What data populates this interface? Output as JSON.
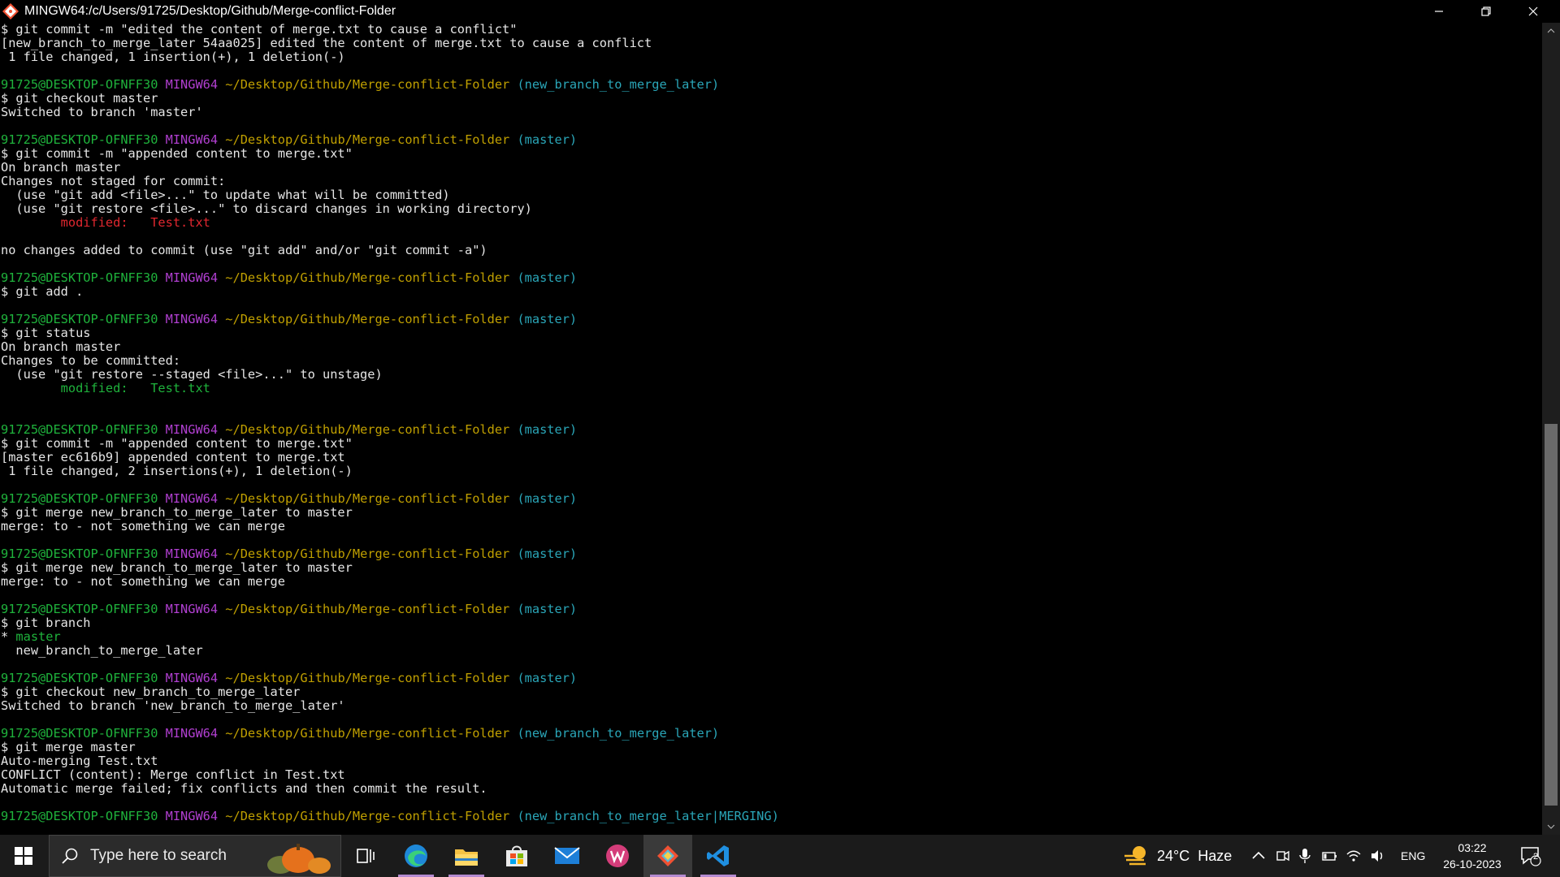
{
  "window": {
    "title": "MINGW64:/c/Users/91725/Desktop/Github/Merge-conflict-Folder"
  },
  "terminal": {
    "lines": [
      [
        {
          "t": "$ git commit -m \"edited the content of merge.txt to cause a conflict\"",
          "c": "w"
        }
      ],
      [
        {
          "t": "[new_branch_to_merge_later 54aa025] edited the content of merge.txt to cause a conflict",
          "c": "w"
        }
      ],
      [
        {
          "t": " 1 file changed, 1 insertion(+), 1 deletion(-)",
          "c": "w"
        }
      ],
      [],
      [
        {
          "t": "91725@DESKTOP-OFNFF30 ",
          "c": "g"
        },
        {
          "t": "MINGW64 ",
          "c": "m"
        },
        {
          "t": "~/Desktop/Github/Merge-conflict-Folder ",
          "c": "y"
        },
        {
          "t": "(new_branch_to_merge_later)",
          "c": "c"
        }
      ],
      [
        {
          "t": "$ git checkout master",
          "c": "w"
        }
      ],
      [
        {
          "t": "Switched to branch 'master'",
          "c": "w"
        }
      ],
      [],
      [
        {
          "t": "91725@DESKTOP-OFNFF30 ",
          "c": "g"
        },
        {
          "t": "MINGW64 ",
          "c": "m"
        },
        {
          "t": "~/Desktop/Github/Merge-conflict-Folder ",
          "c": "y"
        },
        {
          "t": "(master)",
          "c": "c"
        }
      ],
      [
        {
          "t": "$ git commit -m \"appended content to merge.txt\"",
          "c": "w"
        }
      ],
      [
        {
          "t": "On branch master",
          "c": "w"
        }
      ],
      [
        {
          "t": "Changes not staged for commit:",
          "c": "w"
        }
      ],
      [
        {
          "t": "  (use \"git add <file>...\" to update what will be committed)",
          "c": "w"
        }
      ],
      [
        {
          "t": "  (use \"git restore <file>...\" to discard changes in working directory)",
          "c": "w"
        }
      ],
      [
        {
          "t": "        modified:   Test.txt",
          "c": "r"
        }
      ],
      [],
      [
        {
          "t": "no changes added to commit (use \"git add\" and/or \"git commit -a\")",
          "c": "w"
        }
      ],
      [],
      [
        {
          "t": "91725@DESKTOP-OFNFF30 ",
          "c": "g"
        },
        {
          "t": "MINGW64 ",
          "c": "m"
        },
        {
          "t": "~/Desktop/Github/Merge-conflict-Folder ",
          "c": "y"
        },
        {
          "t": "(master)",
          "c": "c"
        }
      ],
      [
        {
          "t": "$ git add .",
          "c": "w"
        }
      ],
      [],
      [
        {
          "t": "91725@DESKTOP-OFNFF30 ",
          "c": "g"
        },
        {
          "t": "MINGW64 ",
          "c": "m"
        },
        {
          "t": "~/Desktop/Github/Merge-conflict-Folder ",
          "c": "y"
        },
        {
          "t": "(master)",
          "c": "c"
        }
      ],
      [
        {
          "t": "$ git status",
          "c": "w"
        }
      ],
      [
        {
          "t": "On branch master",
          "c": "w"
        }
      ],
      [
        {
          "t": "Changes to be committed:",
          "c": "w"
        }
      ],
      [
        {
          "t": "  (use \"git restore --staged <file>...\" to unstage)",
          "c": "w"
        }
      ],
      [
        {
          "t": "        modified:   Test.txt",
          "c": "g"
        }
      ],
      [],
      [],
      [
        {
          "t": "91725@DESKTOP-OFNFF30 ",
          "c": "g"
        },
        {
          "t": "MINGW64 ",
          "c": "m"
        },
        {
          "t": "~/Desktop/Github/Merge-conflict-Folder ",
          "c": "y"
        },
        {
          "t": "(master)",
          "c": "c"
        }
      ],
      [
        {
          "t": "$ git commit -m \"appended content to merge.txt\"",
          "c": "w"
        }
      ],
      [
        {
          "t": "[master ec616b9] appended content to merge.txt",
          "c": "w"
        }
      ],
      [
        {
          "t": " 1 file changed, 2 insertions(+), 1 deletion(-)",
          "c": "w"
        }
      ],
      [],
      [
        {
          "t": "91725@DESKTOP-OFNFF30 ",
          "c": "g"
        },
        {
          "t": "MINGW64 ",
          "c": "m"
        },
        {
          "t": "~/Desktop/Github/Merge-conflict-Folder ",
          "c": "y"
        },
        {
          "t": "(master)",
          "c": "c"
        }
      ],
      [
        {
          "t": "$ git merge new_branch_to_merge_later to master",
          "c": "w"
        }
      ],
      [
        {
          "t": "merge: to - not something we can merge",
          "c": "w"
        }
      ],
      [],
      [
        {
          "t": "91725@DESKTOP-OFNFF30 ",
          "c": "g"
        },
        {
          "t": "MINGW64 ",
          "c": "m"
        },
        {
          "t": "~/Desktop/Github/Merge-conflict-Folder ",
          "c": "y"
        },
        {
          "t": "(master)",
          "c": "c"
        }
      ],
      [
        {
          "t": "$ git merge new_branch_to_merge_later to master",
          "c": "w"
        }
      ],
      [
        {
          "t": "merge: to - not something we can merge",
          "c": "w"
        }
      ],
      [],
      [
        {
          "t": "91725@DESKTOP-OFNFF30 ",
          "c": "g"
        },
        {
          "t": "MINGW64 ",
          "c": "m"
        },
        {
          "t": "~/Desktop/Github/Merge-conflict-Folder ",
          "c": "y"
        },
        {
          "t": "(master)",
          "c": "c"
        }
      ],
      [
        {
          "t": "$ git branch",
          "c": "w"
        }
      ],
      [
        {
          "t": "* ",
          "c": "w"
        },
        {
          "t": "master",
          "c": "g"
        }
      ],
      [
        {
          "t": "  new_branch_to_merge_later",
          "c": "w"
        }
      ],
      [],
      [
        {
          "t": "91725@DESKTOP-OFNFF30 ",
          "c": "g"
        },
        {
          "t": "MINGW64 ",
          "c": "m"
        },
        {
          "t": "~/Desktop/Github/Merge-conflict-Folder ",
          "c": "y"
        },
        {
          "t": "(master)",
          "c": "c"
        }
      ],
      [
        {
          "t": "$ git checkout new_branch_to_merge_later",
          "c": "w"
        }
      ],
      [
        {
          "t": "Switched to branch 'new_branch_to_merge_later'",
          "c": "w"
        }
      ],
      [],
      [
        {
          "t": "91725@DESKTOP-OFNFF30 ",
          "c": "g"
        },
        {
          "t": "MINGW64 ",
          "c": "m"
        },
        {
          "t": "~/Desktop/Github/Merge-conflict-Folder ",
          "c": "y"
        },
        {
          "t": "(new_branch_to_merge_later)",
          "c": "c"
        }
      ],
      [
        {
          "t": "$ git merge master",
          "c": "w"
        }
      ],
      [
        {
          "t": "Auto-merging Test.txt",
          "c": "w"
        }
      ],
      [
        {
          "t": "CONFLICT (content): Merge conflict in Test.txt",
          "c": "w"
        }
      ],
      [
        {
          "t": "Automatic merge failed; fix conflicts and then commit the result.",
          "c": "w"
        }
      ],
      [],
      [
        {
          "t": "91725@DESKTOP-OFNFF30 ",
          "c": "g"
        },
        {
          "t": "MINGW64 ",
          "c": "m"
        },
        {
          "t": "~/Desktop/Github/Merge-conflict-Folder ",
          "c": "y"
        },
        {
          "t": "(new_branch_to_merge_later|MERGING)",
          "c": "c"
        }
      ]
    ]
  },
  "taskbar": {
    "search_placeholder": "Type here to search",
    "apps": [
      "task-view-icon",
      "edge-icon",
      "file-explorer-icon",
      "store-icon",
      "mail-icon",
      "wps-icon",
      "git-bash-icon",
      "vscode-icon"
    ],
    "weather": {
      "temp": "24°C",
      "condition": "Haze"
    },
    "language": "ENG",
    "time": "03:22",
    "date": "26-10-2023",
    "notifications": "2"
  },
  "colors": {
    "prompt_user": "#1fb33c",
    "prompt_mingw": "#b13fd1",
    "prompt_path": "#c0a000",
    "prompt_branch": "#2aa6b8",
    "modified_unstaged": "#e0272f",
    "modified_staged": "#1fb33c"
  }
}
